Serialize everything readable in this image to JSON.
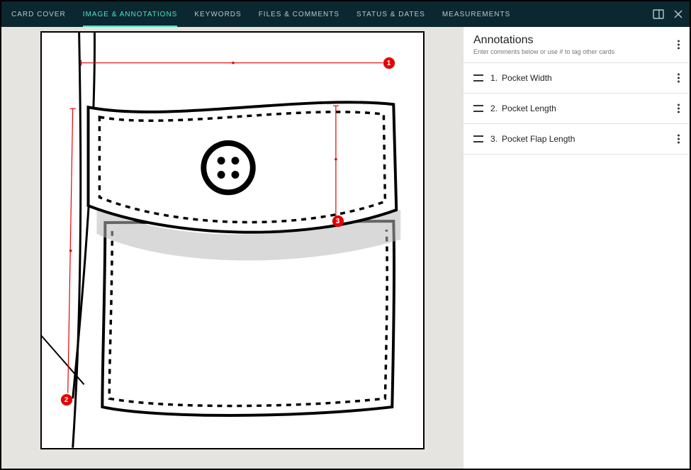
{
  "tabs": {
    "card_cover": "CARD COVER",
    "image_annotations": "IMAGE & ANNOTATIONS",
    "keywords": "KEYWORDS",
    "files_comments": "FILES & COMMENTS",
    "status_dates": "STATUS & DATES",
    "measurements": "MEASUREMENTS"
  },
  "panel": {
    "title": "Annotations",
    "subtitle": "Enter comments below or use # to tag other cards",
    "items": [
      {
        "num": "1.",
        "label": "Pocket Width"
      },
      {
        "num": "2.",
        "label": "Pocket Length"
      },
      {
        "num": "3.",
        "label": "Pocket Flap Length"
      }
    ]
  },
  "markers": {
    "m1": "1",
    "m2": "2",
    "m3": "3"
  },
  "colors": {
    "accent": "#4fe1c2",
    "marker": "#e40000",
    "bg": "#e6e4e0",
    "topbar": "#0b2730"
  }
}
